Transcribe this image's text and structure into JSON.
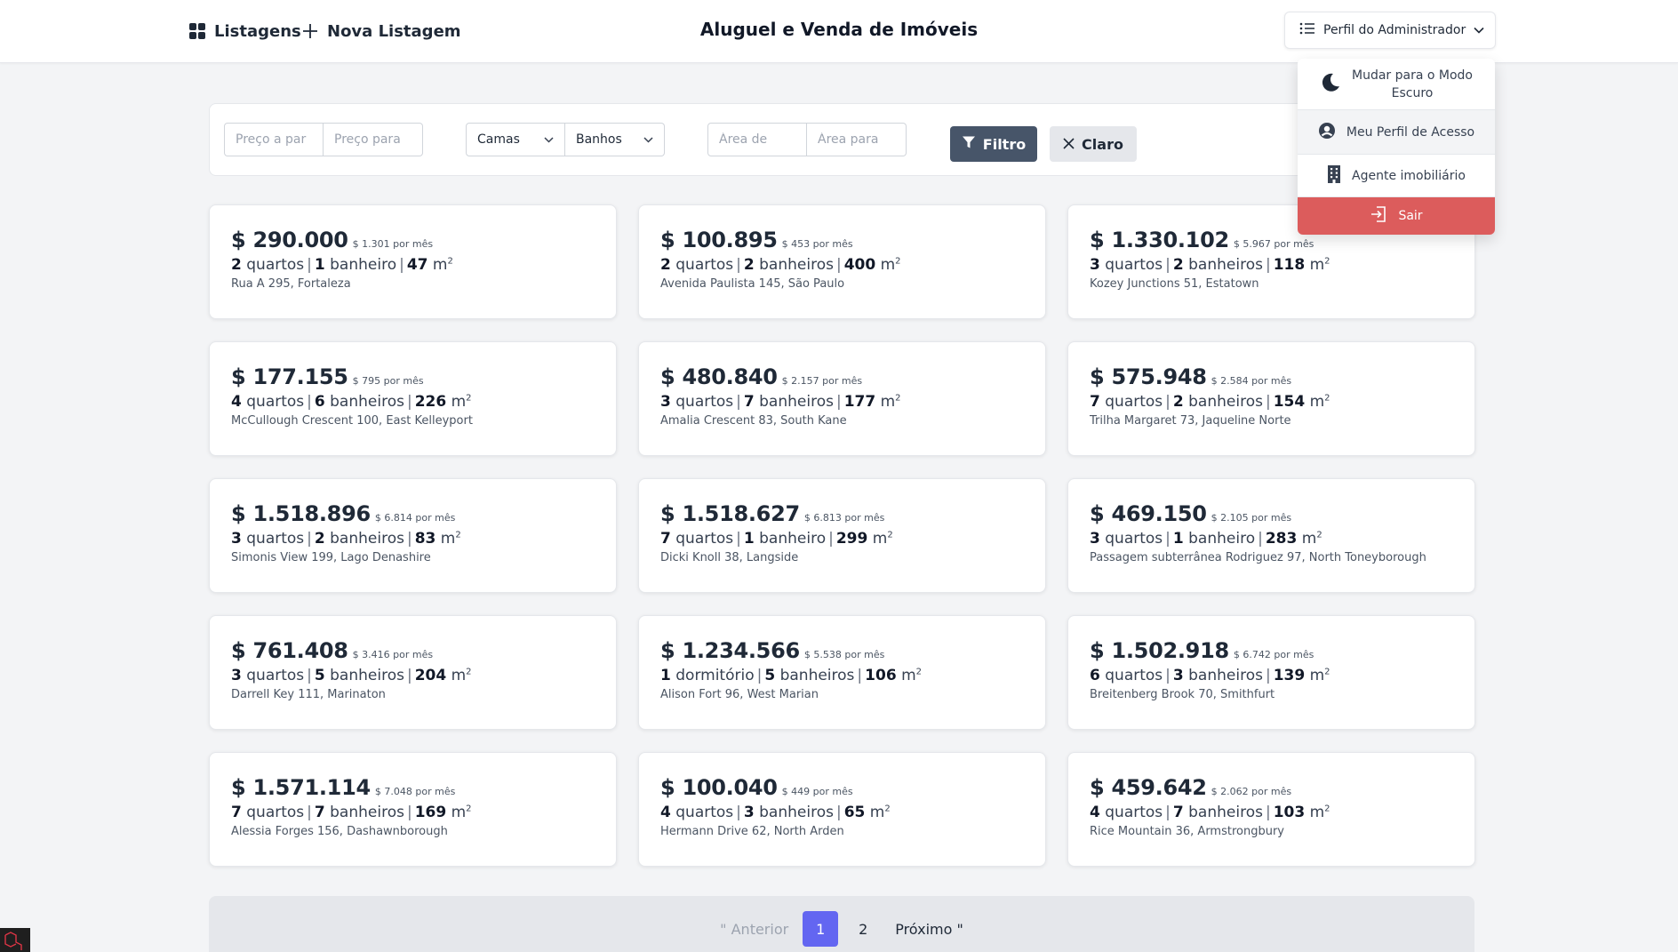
{
  "header": {
    "nav_listings": "Listagens",
    "nav_new_listing": "Nova Listagem",
    "title": "Aluguel e Venda de Imóveis",
    "profile_button": "Perfil do Administrador"
  },
  "dropdown": {
    "dark_mode_line1": "Mudar para o Modo",
    "dark_mode_line2": "Escuro",
    "my_profile": "Meu Perfil de Acesso",
    "agent": "Agente imobiliário",
    "logout": "Sair"
  },
  "filters": {
    "price_from_placeholder": "Preço a par",
    "price_to_placeholder": "Preço para",
    "beds_label": "Camas",
    "baths_label": "Banhos",
    "area_from_placeholder": "Área de",
    "area_to_placeholder": "Área para",
    "filter_button": "Filtro",
    "clear_button": "Claro"
  },
  "listings": [
    {
      "price": "$ 290.000",
      "monthly": "$ 1.301 por mês",
      "beds": "2",
      "beds_label": "quartos",
      "baths": "1",
      "baths_label": "banheiro",
      "area": "47",
      "address": "Rua A 295, Fortaleza"
    },
    {
      "price": "$ 100.895",
      "monthly": "$ 453 por mês",
      "beds": "2",
      "beds_label": "quartos",
      "baths": "2",
      "baths_label": "banheiros",
      "area": "400",
      "address": "Avenida Paulista 145, São Paulo"
    },
    {
      "price": "$ 1.330.102",
      "monthly": "$ 5.967 por mês",
      "beds": "3",
      "beds_label": "quartos",
      "baths": "2",
      "baths_label": "banheiros",
      "area": "118",
      "address": "Kozey Junctions 51, Estatown"
    },
    {
      "price": "$ 177.155",
      "monthly": "$ 795 por mês",
      "beds": "4",
      "beds_label": "quartos",
      "baths": "6",
      "baths_label": "banheiros",
      "area": "226",
      "address": "McCullough Crescent 100, East Kelleyport"
    },
    {
      "price": "$ 480.840",
      "monthly": "$ 2.157 por mês",
      "beds": "3",
      "beds_label": "quartos",
      "baths": "7",
      "baths_label": "banheiros",
      "area": "177",
      "address": "Amalia Crescent 83, South Kane"
    },
    {
      "price": "$ 575.948",
      "monthly": "$ 2.584 por mês",
      "beds": "7",
      "beds_label": "quartos",
      "baths": "2",
      "baths_label": "banheiros",
      "area": "154",
      "address": "Trilha Margaret 73, Jaqueline Norte"
    },
    {
      "price": "$ 1.518.896",
      "monthly": "$ 6.814 por mês",
      "beds": "3",
      "beds_label": "quartos",
      "baths": "2",
      "baths_label": "banheiros",
      "area": "83",
      "address": "Simonis View 199, Lago Denashire"
    },
    {
      "price": "$ 1.518.627",
      "monthly": "$ 6.813 por mês",
      "beds": "7",
      "beds_label": "quartos",
      "baths": "1",
      "baths_label": "banheiro",
      "area": "299",
      "address": "Dicki Knoll 38, Langside"
    },
    {
      "price": "$ 469.150",
      "monthly": "$ 2.105 por mês",
      "beds": "3",
      "beds_label": "quartos",
      "baths": "1",
      "baths_label": "banheiro",
      "area": "283",
      "address": "Passagem subterrânea Rodriguez 97, North Toneyborough"
    },
    {
      "price": "$ 761.408",
      "monthly": "$ 3.416 por mês",
      "beds": "3",
      "beds_label": "quartos",
      "baths": "5",
      "baths_label": "banheiros",
      "area": "204",
      "address": "Darrell Key 111, Marinaton"
    },
    {
      "price": "$ 1.234.566",
      "monthly": "$ 5.538 por mês",
      "beds": "1",
      "beds_label": "dormitório",
      "baths": "5",
      "baths_label": "banheiros",
      "area": "106",
      "address": "Alison Fort 96, West Marian"
    },
    {
      "price": "$ 1.502.918",
      "monthly": "$ 6.742 por mês",
      "beds": "6",
      "beds_label": "quartos",
      "baths": "3",
      "baths_label": "banheiros",
      "area": "139",
      "address": "Breitenberg Brook 70, Smithfurt"
    },
    {
      "price": "$ 1.571.114",
      "monthly": "$ 7.048 por mês",
      "beds": "7",
      "beds_label": "quartos",
      "baths": "7",
      "baths_label": "banheiros",
      "area": "169",
      "address": "Alessia Forges 156, Dashawnborough"
    },
    {
      "price": "$ 100.040",
      "monthly": "$ 449 por mês",
      "beds": "4",
      "beds_label": "quartos",
      "baths": "3",
      "baths_label": "banheiros",
      "area": "65",
      "address": "Hermann Drive 62, North Arden"
    },
    {
      "price": "$ 459.642",
      "monthly": "$ 2.062 por mês",
      "beds": "4",
      "beds_label": "quartos",
      "baths": "7",
      "baths_label": "banheiros",
      "area": "103",
      "address": "Rice Mountain 36, Armstrongbury"
    }
  ],
  "listing_unit": "m",
  "listing_unit_exp": "2",
  "pagination": {
    "prev": "\" Anterior",
    "pages": [
      "1",
      "2"
    ],
    "current": "1",
    "next": "Próximo \""
  },
  "colors": {
    "filter_button": "#475569",
    "logout": "#dc5c5c",
    "active_page": "#6366f1"
  },
  "icons": [
    "grid-icon",
    "plus-icon",
    "list-icon",
    "chevron-down-icon",
    "moon-icon",
    "user-circle-icon",
    "building-icon",
    "logout-icon",
    "filter-icon",
    "close-icon"
  ]
}
